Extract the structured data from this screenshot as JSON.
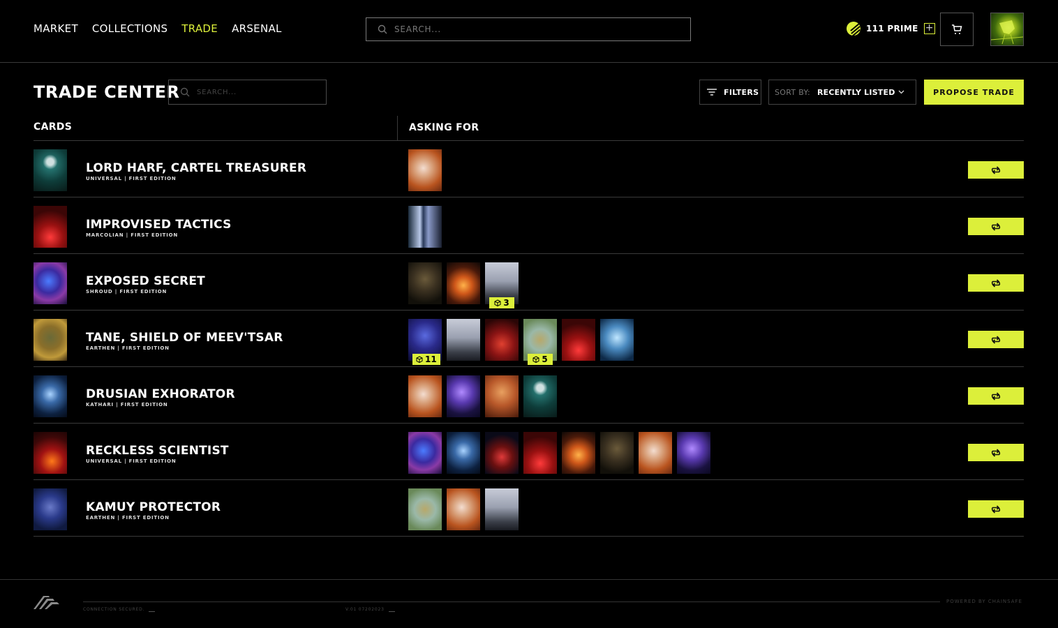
{
  "nav": {
    "links": [
      {
        "label": "MARKET",
        "active": false
      },
      {
        "label": "COLLECTIONS",
        "active": false
      },
      {
        "label": "TRADE",
        "active": true
      },
      {
        "label": "ARSENAL",
        "active": false
      }
    ],
    "search_placeholder": "SEARCH...",
    "prime_balance": "111 PRIME",
    "icons": {
      "coin": "prime-coin-icon",
      "add": "plus-icon",
      "cart": "cart-icon",
      "avatar": "user-avatar"
    }
  },
  "page": {
    "title": "TRADE CENTER",
    "search_placeholder": "SEARCH...",
    "filters_label": "FILTERS",
    "sort_label": "SORT BY:",
    "sort_value": "RECENTLY LISTED",
    "propose_label": "PROPOSE TRADE"
  },
  "table": {
    "columns": {
      "cards": "CARDS",
      "asking": "ASKING FOR"
    },
    "rows": [
      {
        "name": "LORD HARF, CARTEL TREASURER",
        "sub": "UNIVERSAL | FIRST EDITION",
        "art": "harf",
        "asks": [
          {
            "art": "mech"
          }
        ]
      },
      {
        "name": "IMPROVISED TACTICS",
        "sub": "MARCOLIAN | FIRST EDITION",
        "art": "tactics",
        "asks": [
          {
            "art": "beam"
          }
        ]
      },
      {
        "name": "EXPOSED SECRET",
        "sub": "SHROUD | FIRST EDITION",
        "art": "secret",
        "asks": [
          {
            "art": "helm"
          },
          {
            "art": "fire"
          },
          {
            "art": "warrior",
            "qty": "3"
          }
        ]
      },
      {
        "name": "TANE, SHIELD OF MEEV'TSAR",
        "sub": "EARTHEN | FIRST EDITION",
        "art": "tane",
        "asks": [
          {
            "art": "nightfight",
            "qty": "11"
          },
          {
            "art": "warrior"
          },
          {
            "art": "redcity"
          },
          {
            "art": "jungle",
            "qty": "5"
          },
          {
            "art": "tactics"
          },
          {
            "art": "ice"
          }
        ]
      },
      {
        "name": "DRUSIAN EXHORATOR",
        "sub": "KATHARI | FIRST EDITION",
        "art": "drusian",
        "asks": [
          {
            "art": "mech"
          },
          {
            "art": "cosmos"
          },
          {
            "art": "gunslinger"
          },
          {
            "art": "harf"
          }
        ]
      },
      {
        "name": "RECKLESS SCIENTIST",
        "sub": "UNIVERSAL | FIRST EDITION",
        "art": "reckless",
        "asks": [
          {
            "art": "secret"
          },
          {
            "art": "drusian"
          },
          {
            "art": "dancer"
          },
          {
            "art": "tactics"
          },
          {
            "art": "fire"
          },
          {
            "art": "helm"
          },
          {
            "art": "mech"
          },
          {
            "art": "cosmos"
          }
        ]
      },
      {
        "name": "KAMUY PROTECTOR",
        "sub": "EARTHEN | FIRST EDITION",
        "art": "kamuy",
        "asks": [
          {
            "art": "jungle"
          },
          {
            "art": "mech"
          },
          {
            "art": "warrior"
          }
        ]
      }
    ]
  },
  "footer": {
    "status": "CONNECTION SECURED.",
    "version": "V.01 07202023",
    "powered": "POWERED BY CHAINSAFE"
  },
  "colors": {
    "accent": "#dcef3a",
    "background": "#000000",
    "divider": "#3a3a3a"
  }
}
